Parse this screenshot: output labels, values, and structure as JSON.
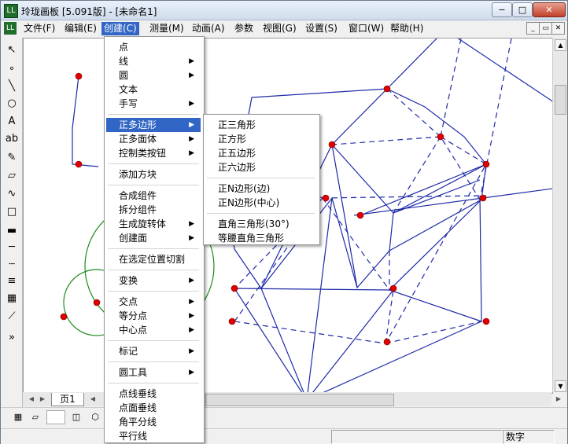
{
  "window": {
    "title": "玲珑画板  [5.091版] - [未命名1]",
    "controls": {
      "minimize": "−",
      "maximize": "□",
      "close": "✕"
    }
  },
  "menubar": {
    "items": [
      "文件(F)",
      "编辑(E)",
      "创建(C)",
      "测量(M)",
      "动画(A)",
      "参数",
      "视图(G)",
      "设置(S)",
      "窗口(W)",
      "帮助(H)"
    ],
    "active": "创建(C)",
    "mdi_controls": {
      "minimize": "_",
      "restore": "▭",
      "close": "✕"
    }
  },
  "toolbar": {
    "tools": [
      {
        "icon": "arrow-pointer-icon",
        "glyph": "↖"
      },
      {
        "icon": "point-icon",
        "glyph": "∘"
      },
      {
        "icon": "line-icon",
        "glyph": "╲"
      },
      {
        "icon": "circle-icon",
        "glyph": "○"
      },
      {
        "icon": "text-A-icon",
        "glyph": "A"
      },
      {
        "icon": "text-ab-icon",
        "glyph": "ab"
      },
      {
        "icon": "pencil-icon",
        "glyph": "✎"
      },
      {
        "icon": "eraser-icon",
        "glyph": "▱"
      },
      {
        "icon": "curve-icon",
        "glyph": "∿"
      },
      {
        "icon": "rectangle-icon",
        "glyph": "□"
      },
      {
        "icon": "thick-line-icon",
        "glyph": "▬"
      },
      {
        "icon": "thin-line-icon",
        "glyph": "─"
      },
      {
        "icon": "dotted-line-icon",
        "glyph": "┄"
      },
      {
        "icon": "line-style-icon",
        "glyph": "≡"
      },
      {
        "icon": "color-palette-icon",
        "glyph": "▦"
      },
      {
        "icon": "graph-icon",
        "glyph": "⟋"
      },
      {
        "icon": "play-forward-icon",
        "glyph": "»"
      }
    ]
  },
  "create_menu": {
    "items": [
      {
        "label": "点",
        "submenu": false
      },
      {
        "label": "线",
        "submenu": true
      },
      {
        "label": "圆",
        "submenu": true
      },
      {
        "label": "文本",
        "submenu": false
      },
      {
        "label": "手写",
        "submenu": true
      },
      {
        "sep": true
      },
      {
        "label": "正多边形",
        "submenu": true,
        "highlighted": true
      },
      {
        "label": "正多面体",
        "submenu": true
      },
      {
        "label": "控制类按钮",
        "submenu": true
      },
      {
        "sep": true
      },
      {
        "label": "添加方块",
        "submenu": false
      },
      {
        "sep": true
      },
      {
        "label": "合成组件",
        "submenu": false
      },
      {
        "label": "拆分组件",
        "submenu": false
      },
      {
        "label": "生成旋转体",
        "submenu": true
      },
      {
        "label": "创建面",
        "submenu": true
      },
      {
        "sep": true
      },
      {
        "label": "在选定位置切割",
        "submenu": false
      },
      {
        "sep": true
      },
      {
        "label": "变换",
        "submenu": true
      },
      {
        "sep": true
      },
      {
        "label": "交点",
        "submenu": true
      },
      {
        "label": "等分点",
        "submenu": true
      },
      {
        "label": "中心点",
        "submenu": true
      },
      {
        "sep": true
      },
      {
        "label": "标记",
        "submenu": true
      },
      {
        "sep": true
      },
      {
        "label": "圆工具",
        "submenu": true
      },
      {
        "sep": true
      },
      {
        "label": "点线垂线",
        "submenu": false
      },
      {
        "label": "点面垂线",
        "submenu": false
      },
      {
        "label": "角平分线",
        "submenu": false
      },
      {
        "label": "平行线",
        "submenu": false
      }
    ]
  },
  "polygon_submenu": {
    "items": [
      {
        "label": "正三角形"
      },
      {
        "label": "正方形"
      },
      {
        "label": "正五边形"
      },
      {
        "label": "正六边形"
      },
      {
        "sep": true
      },
      {
        "label": "正N边形(边)"
      },
      {
        "label": "正N边形(中心)"
      },
      {
        "sep": true
      },
      {
        "label": "直角三角形(30°)"
      },
      {
        "label": "等腰直角三角形"
      }
    ]
  },
  "page_tabs": {
    "current": "页1"
  },
  "bottom_tools": [
    "grid-icon",
    "skew-grid-icon",
    "blank-icon",
    "cube-front-icon",
    "cube-iso-icon"
  ],
  "status": {
    "mode": "数字"
  },
  "colors": {
    "accent": "#3166c6",
    "line": "#1e2aa8",
    "point": "#e00000",
    "circle": "#1a8a1a"
  }
}
